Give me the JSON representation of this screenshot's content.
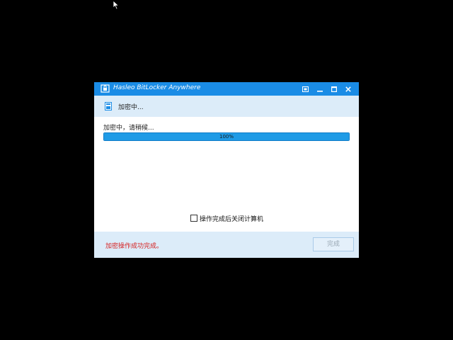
{
  "window": {
    "title": "Hasleo BitLocker Anywhere"
  },
  "header": {
    "step_label": "加密中..."
  },
  "main": {
    "status_text": "加密中，请稍候...",
    "progress_value": 100,
    "progress_text": "100%",
    "checkbox_label": "操作完成后关闭计算机",
    "checkbox_checked": false
  },
  "footer": {
    "result_text": "加密操作成功完成。",
    "finish_label": "完成"
  },
  "colors": {
    "titlebar": "#1a8ce6",
    "band": "#dcecf9",
    "progress_fill": "#1f9be6",
    "result_text": "#d62020"
  },
  "icons": [
    "mouse-cursor-icon",
    "app-icon",
    "restore-icon",
    "minimize-icon",
    "maximize-icon",
    "close-icon",
    "step-icon"
  ]
}
